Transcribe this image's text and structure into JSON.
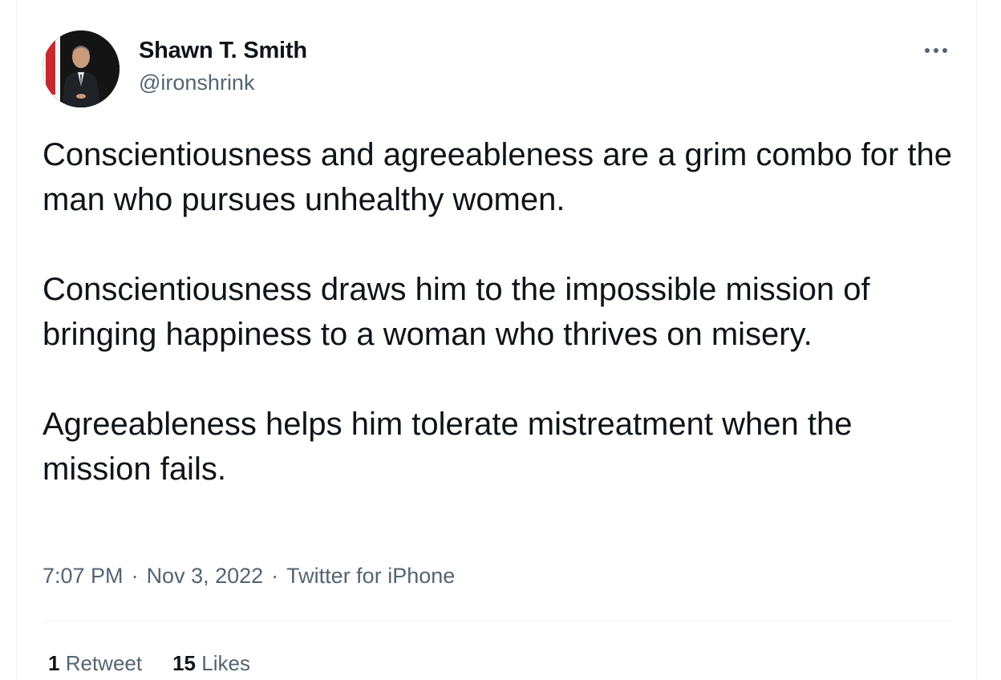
{
  "author": {
    "name": "Shawn T. Smith",
    "handle": "@ironshrink"
  },
  "tweet": {
    "paragraphs": [
      "Conscientiousness and agreeableness are a grim combo for the man who pursues unhealthy women.",
      "Conscientiousness draws him to the impossible mission of bringing happiness to a woman who thrives on misery.",
      "Agreeableness helps him tolerate mistreatment when the mission fails."
    ],
    "time": "7:07 PM",
    "date": "Nov 3, 2022",
    "source": "Twitter for iPhone",
    "separator": "·"
  },
  "stats": {
    "retweets_count": "1",
    "retweets_label": "Retweet",
    "likes_count": "15",
    "likes_label": "Likes"
  },
  "icons": {
    "more": "more-options-icon",
    "avatar": "profile-photo"
  },
  "colors": {
    "text": "#0f1419",
    "secondary": "#536471",
    "border": "#eff3f4"
  }
}
